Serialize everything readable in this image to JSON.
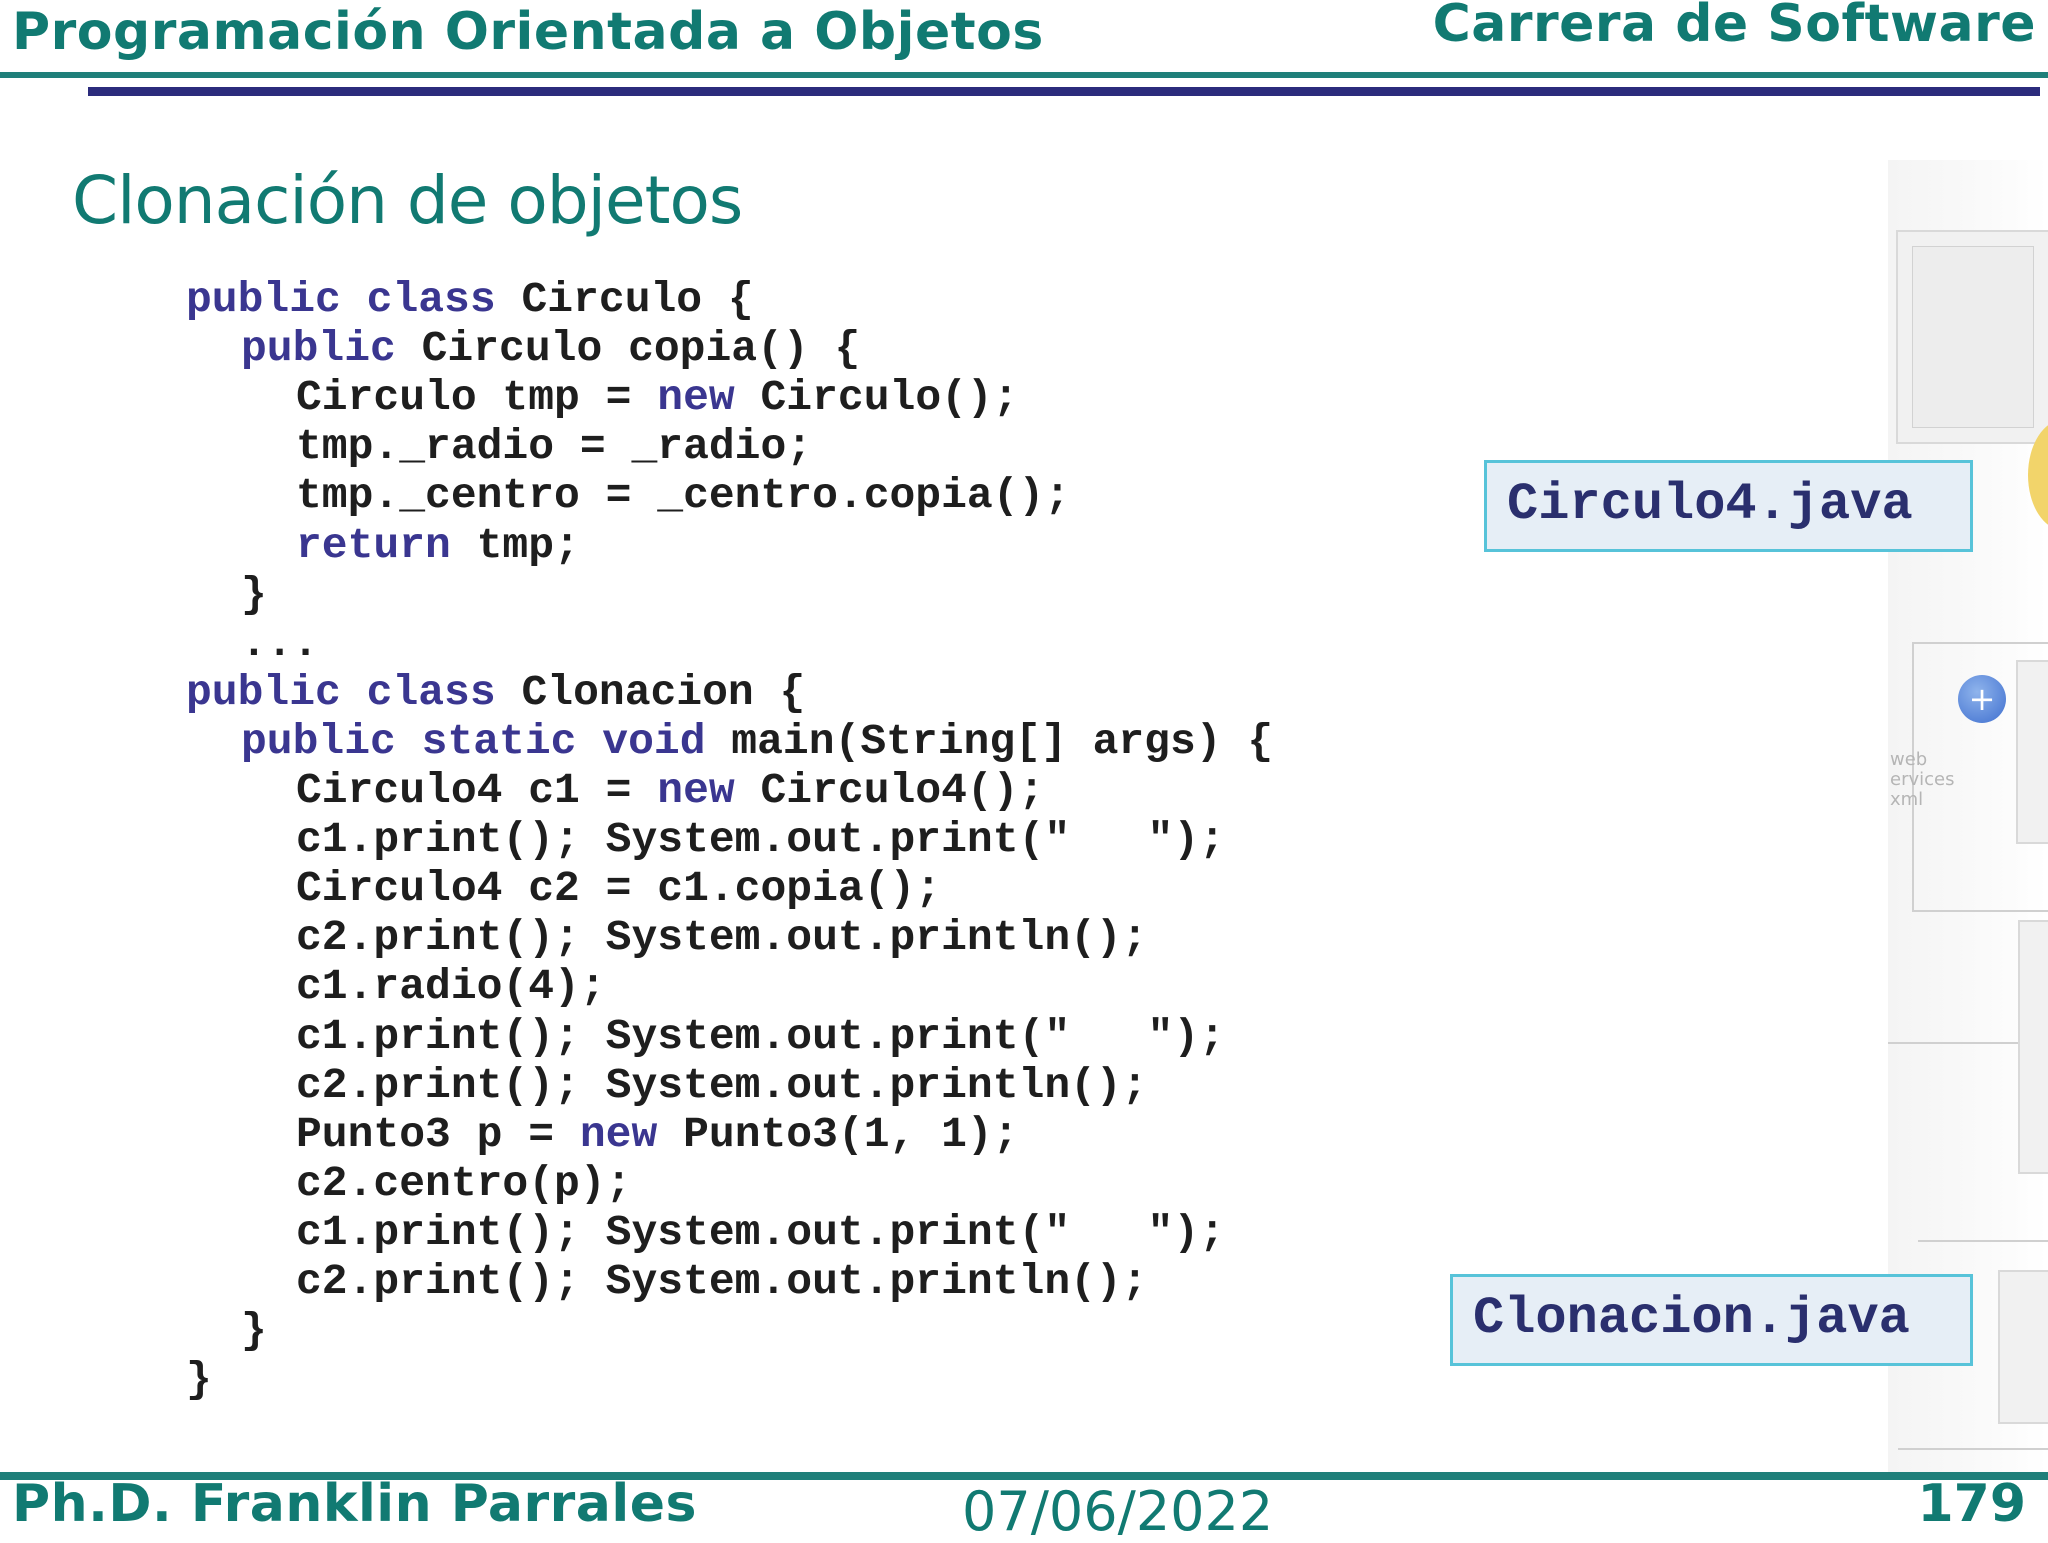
{
  "header": {
    "course_title": "Programación Orientada a Objetos",
    "program_name": "Carrera de Software"
  },
  "slide": {
    "title": "Clonación de objetos"
  },
  "code": {
    "lines": [
      [
        {
          "t": "public",
          "k": true
        },
        {
          "t": " "
        },
        {
          "t": "class",
          "k": true
        },
        {
          "t": " Circulo {"
        }
      ],
      [
        {
          "t": "  "
        },
        {
          "t": "public",
          "k": true
        },
        {
          "t": " Circulo copia() {"
        }
      ],
      [
        {
          "t": "    Circulo tmp = "
        },
        {
          "t": "new",
          "k": true
        },
        {
          "t": " Circulo();"
        }
      ],
      [
        {
          "t": "    tmp._radio = _radio;"
        }
      ],
      [
        {
          "t": "    tmp._centro = _centro.copia();"
        }
      ],
      [
        {
          "t": "    "
        },
        {
          "t": "return",
          "k": true
        },
        {
          "t": " tmp;"
        }
      ],
      [
        {
          "t": "  }"
        }
      ],
      [
        {
          "t": "  ..."
        }
      ],
      [
        {
          "t": "public",
          "k": true
        },
        {
          "t": " "
        },
        {
          "t": "class",
          "k": true
        },
        {
          "t": " Clonacion {"
        }
      ],
      [
        {
          "t": "  "
        },
        {
          "t": "public",
          "k": true
        },
        {
          "t": " "
        },
        {
          "t": "static",
          "k": true
        },
        {
          "t": " "
        },
        {
          "t": "void",
          "k": true
        },
        {
          "t": " main(String[] args) {"
        }
      ],
      [
        {
          "t": "    Circulo4 c1 = "
        },
        {
          "t": "new",
          "k": true
        },
        {
          "t": " Circulo4();"
        }
      ],
      [
        {
          "t": "    c1.print(); System.out.print(\"   \");"
        }
      ],
      [
        {
          "t": "    Circulo4 c2 = c1.copia();"
        }
      ],
      [
        {
          "t": "    c2.print(); System.out.println();"
        }
      ],
      [
        {
          "t": "    c1.radio(4);"
        }
      ],
      [
        {
          "t": "    c1.print(); System.out.print(\"   \");"
        }
      ],
      [
        {
          "t": "    c2.print(); System.out.println();"
        }
      ],
      [
        {
          "t": "    Punto3 p = "
        },
        {
          "t": "new",
          "k": true
        },
        {
          "t": " Punto3(1, 1);"
        }
      ],
      [
        {
          "t": "    c2.centro(p);"
        }
      ],
      [
        {
          "t": "    c1.print(); System.out.print(\"   \");"
        }
      ],
      [
        {
          "t": "    c2.print(); System.out.println();"
        }
      ],
      [
        {
          "t": "  }"
        }
      ],
      [
        {
          "t": "}"
        }
      ]
    ]
  },
  "file_labels": {
    "circulo4": "Circulo4.java",
    "clonacion": "Clonacion.java"
  },
  "decoration": {
    "web_services_text": [
      "web",
      "ervices",
      "xml"
    ],
    "add_bubble_glyph": "+"
  },
  "footer": {
    "author": "Ph.D. Franklin Parrales",
    "date": "07/06/2022",
    "page_number": "179"
  },
  "colors": {
    "teal_heading": "#117a72",
    "keyword": "#3a3690",
    "navy_rule": "#2b2b7c",
    "label_border": "#57c3d9",
    "label_bg": "#e6eef6"
  }
}
